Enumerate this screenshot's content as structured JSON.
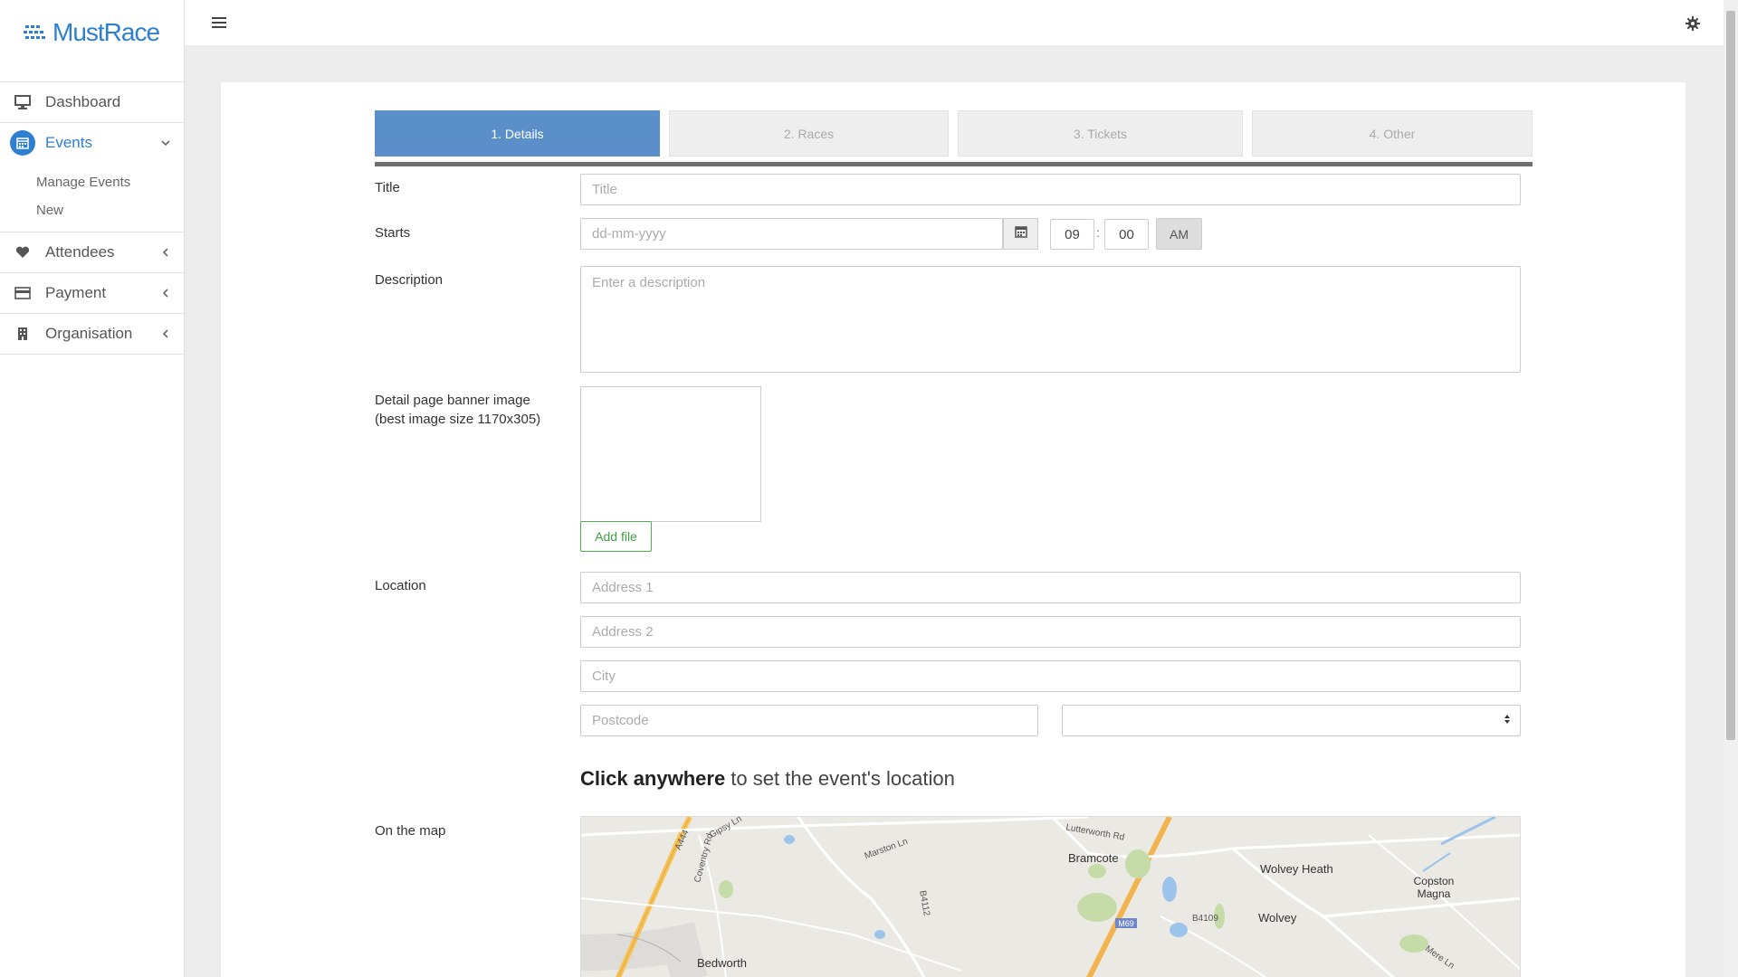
{
  "brand": {
    "name": "MustRace",
    "color": "#2f7fd1"
  },
  "sidebar": {
    "items": [
      {
        "label": "Dashboard",
        "icon": "monitor-icon"
      },
      {
        "label": "Events",
        "icon": "calendar-icon",
        "active": true,
        "expanded": true,
        "children": [
          {
            "label": "Manage Events"
          },
          {
            "label": "New"
          }
        ]
      },
      {
        "label": "Attendees",
        "icon": "heart-icon"
      },
      {
        "label": "Payment",
        "icon": "credit-card-icon"
      },
      {
        "label": "Organisation",
        "icon": "building-icon"
      }
    ]
  },
  "topbar": {
    "menu_icon": "hamburger-icon",
    "settings_icon": "gear-icon"
  },
  "steps": [
    {
      "label": "1. Details",
      "active": true
    },
    {
      "label": "2. Races",
      "active": false
    },
    {
      "label": "3. Tickets",
      "active": false
    },
    {
      "label": "4. Other",
      "active": false
    }
  ],
  "form": {
    "title": {
      "label": "Title",
      "placeholder": "Title",
      "value": ""
    },
    "starts": {
      "label": "Starts",
      "date_placeholder": "dd-mm-yyyy",
      "hour": "09",
      "minute": "00",
      "ampm": "AM",
      "separator": ":"
    },
    "description": {
      "label": "Description",
      "placeholder": "Enter a description"
    },
    "banner": {
      "label_line1": "Detail page banner image",
      "label_line2": "(best image size 1170x305)",
      "add_file": "Add file"
    },
    "location": {
      "label": "Location",
      "address1": "Address 1",
      "address2": "Address 2",
      "city": "City",
      "postcode": "Postcode",
      "country_value": ""
    },
    "map_hint_bold": "Click anywhere",
    "map_hint_rest": " to set the event's location",
    "map_label": "On the map"
  },
  "map": {
    "labels": [
      "Bramcote",
      "Wolvey Heath",
      "Copston Magna",
      "Wolvey",
      "Bedworth",
      "M69",
      "B4109",
      "B4112",
      "A444",
      "Lutterworth Rd",
      "Marston Ln",
      "Gipsy Ln",
      "Mere Ln",
      "Coventry Rd"
    ]
  },
  "colors": {
    "accent": "#5b8fc9",
    "success": "#4caf50",
    "background": "#ececec"
  }
}
